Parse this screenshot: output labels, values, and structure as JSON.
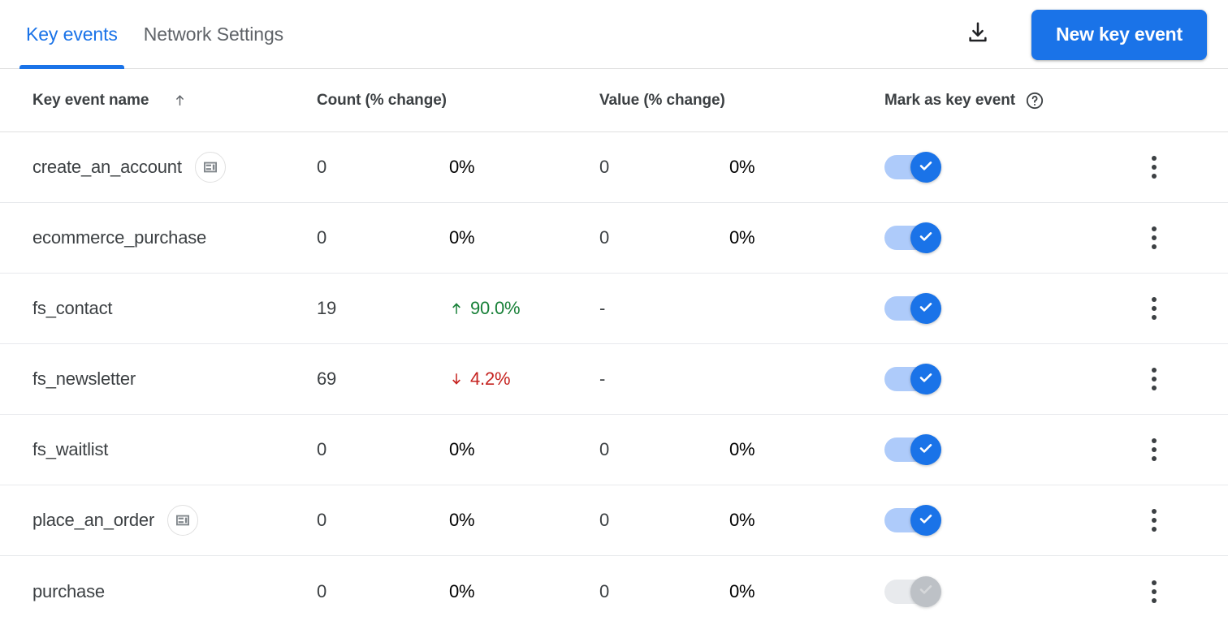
{
  "topbar": {
    "tabs": [
      {
        "label": "Key events",
        "active": true
      },
      {
        "label": "Network Settings",
        "active": false
      }
    ],
    "download_icon": "download-icon",
    "new_key_event_label": "New key event",
    "accent_color": "#1a73e8"
  },
  "table": {
    "columns": {
      "name": "Key event name",
      "count": "Count (% change)",
      "value": "Value (% change)",
      "mark": "Mark as key event"
    },
    "sort": {
      "column": "Key event name",
      "direction": "ascending",
      "icon": "arrow-up-icon"
    },
    "mark_help_icon": "help-circle-icon",
    "rows": [
      {
        "name": "create_an_account",
        "badge": "ad-unit-icon",
        "count": "0",
        "count_change": "0%",
        "count_change_dir": "none",
        "value": "0",
        "value_change": "0%",
        "value_change_dir": "none",
        "marked": true,
        "toggle_disabled": false
      },
      {
        "name": "ecommerce_purchase",
        "badge": null,
        "count": "0",
        "count_change": "0%",
        "count_change_dir": "none",
        "value": "0",
        "value_change": "0%",
        "value_change_dir": "none",
        "marked": true,
        "toggle_disabled": false
      },
      {
        "name": "fs_contact",
        "badge": null,
        "count": "19",
        "count_change": "90.0%",
        "count_change_dir": "up",
        "value": "-",
        "value_change": "",
        "value_change_dir": "none",
        "marked": true,
        "toggle_disabled": false
      },
      {
        "name": "fs_newsletter",
        "badge": null,
        "count": "69",
        "count_change": "4.2%",
        "count_change_dir": "down",
        "value": "-",
        "value_change": "",
        "value_change_dir": "none",
        "marked": true,
        "toggle_disabled": false
      },
      {
        "name": "fs_waitlist",
        "badge": null,
        "count": "0",
        "count_change": "0%",
        "count_change_dir": "none",
        "value": "0",
        "value_change": "0%",
        "value_change_dir": "none",
        "marked": true,
        "toggle_disabled": false
      },
      {
        "name": "place_an_order",
        "badge": "ad-unit-icon",
        "count": "0",
        "count_change": "0%",
        "count_change_dir": "none",
        "value": "0",
        "value_change": "0%",
        "value_change_dir": "none",
        "marked": true,
        "toggle_disabled": false
      },
      {
        "name": "purchase",
        "badge": null,
        "count": "0",
        "count_change": "0%",
        "count_change_dir": "none",
        "value": "0",
        "value_change": "0%",
        "value_change_dir": "none",
        "marked": false,
        "toggle_disabled": true
      }
    ],
    "row_menu_icon": "more-vert-icon",
    "colors": {
      "positive": "#188038",
      "negative": "#c5221f",
      "text": "#3c4043",
      "toggle_on_track": "#aecbfa",
      "toggle_on_thumb": "#1a73e8",
      "toggle_off_track": "#e8eaed",
      "toggle_off_thumb": "#bdc1c6"
    }
  }
}
